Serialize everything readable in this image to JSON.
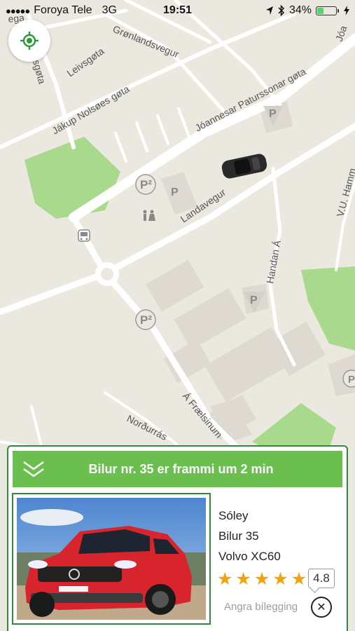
{
  "status_bar": {
    "signal_dots": "●●●●●",
    "carrier": "Foroya Tele",
    "network": "3G",
    "time": "19:51",
    "battery_text": "34%",
    "battery_level": 0.34,
    "icons": [
      "location-arrow-icon",
      "bluetooth-icon",
      "battery-icon",
      "charging-icon"
    ]
  },
  "map": {
    "street_labels": [
      "Grønlandsvegur",
      "Leivsgøta",
      "Jákup Nolsøes gøta",
      "Jóannesar Paturssonar gøta",
      "Landavegur",
      "Handan Á",
      "V.U. Hamm",
      "Norðurrás",
      "Á Frælsinum",
      "ksgøta",
      "ega",
      "Jóa"
    ],
    "parking_markers": [
      "P",
      "P²",
      "P",
      "P",
      "P²",
      "P"
    ],
    "colors": {
      "land": "#ebe8df",
      "road": "#ffffff",
      "park": "#a9d98c",
      "building": "#dedad1"
    }
  },
  "panel": {
    "banner_text": "Bilur nr. 35 er frammi um 2 min",
    "driver_name": "Sóley",
    "car_number": "Bilur 35",
    "car_model": "Volvo XC60",
    "rating": "4.8",
    "stars": 5,
    "cancel_label": "Angra bílegging",
    "accent_color": "#6bbf4e",
    "border_color": "#2e8b3a"
  }
}
